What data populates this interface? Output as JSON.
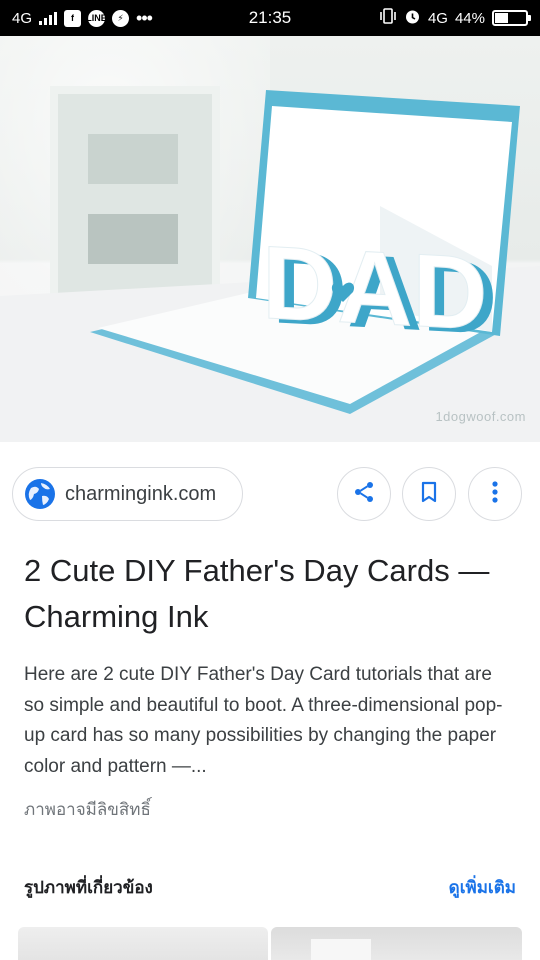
{
  "status_bar": {
    "network_left": "4G",
    "time": "21:35",
    "network_right": "4G",
    "battery_percent": "44%",
    "battery_level": 0.44,
    "icons": [
      "signal-icon",
      "facebook-icon",
      "line-icon",
      "messenger-icon",
      "more-notifications-icon",
      "vibrate-icon",
      "alarm-icon",
      "battery-icon"
    ]
  },
  "hero_image": {
    "card_text": "DAD",
    "watermark": "1dogwoof.com",
    "colors": {
      "card_blue": "#5bb8d4",
      "card_white": "#ffffff"
    }
  },
  "source": {
    "domain": "charmingink.com",
    "actions": [
      "share-icon",
      "bookmark-icon",
      "more-vert-icon"
    ]
  },
  "result": {
    "title": "2 Cute DIY Father's Day Cards — Charming Ink",
    "description": "Here are 2 cute DIY Father's Day Card tutorials that are so simple and beautiful to boot. A three-dimensional pop-up card has so many possibilities by changing the paper color and pattern —...",
    "rights_notice": "ภาพอาจมีลิขสิทธิ์"
  },
  "related": {
    "heading": "รูปภาพที่เกี่ยวข้อง",
    "see_more": "ดูเพิ่มเติม"
  },
  "colors": {
    "accent": "#1a73e8",
    "text": "#202124",
    "muted": "#70757a"
  }
}
